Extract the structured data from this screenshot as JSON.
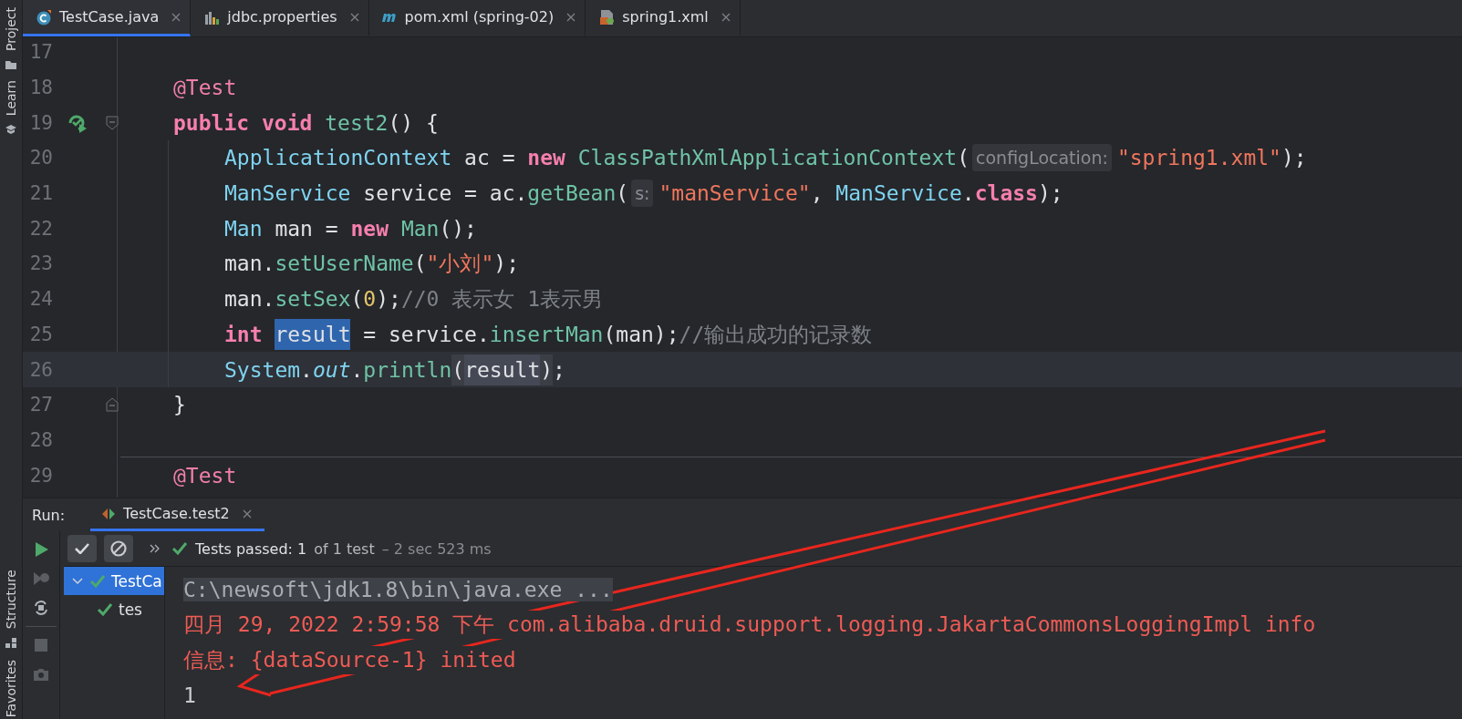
{
  "tool_strip": {
    "top": [
      {
        "label": "Project"
      },
      {
        "label": "Learn"
      }
    ],
    "bottom": [
      {
        "label": "Structure"
      },
      {
        "label": "Favorites"
      }
    ]
  },
  "tabs": [
    {
      "label": "TestCase.java",
      "selected": true
    },
    {
      "label": "jdbc.properties",
      "selected": false
    },
    {
      "label": "pom.xml (spring-02)",
      "selected": false
    },
    {
      "label": "spring1.xml",
      "selected": false
    }
  ],
  "editor": {
    "lines": [
      {
        "number": "17",
        "indented": false
      },
      {
        "number": "18",
        "indented": false,
        "tokens": [
          {
            "kind": "anno",
            "t": "@Test"
          }
        ]
      },
      {
        "number": "19",
        "indented": false,
        "run_icon": true,
        "fold_open": true,
        "tokens": [
          {
            "kind": "kw",
            "t": "public "
          },
          {
            "kind": "kw",
            "t": "void "
          },
          {
            "kind": "call",
            "t": "test2"
          },
          {
            "kind": "plain",
            "t": "() {"
          }
        ]
      },
      {
        "number": "20",
        "indented": true,
        "tokens": [
          {
            "kind": "type",
            "t": "ApplicationContext"
          },
          {
            "kind": "plain",
            "t": " ac = "
          },
          {
            "kind": "kw",
            "t": "new "
          },
          {
            "kind": "call",
            "t": "ClassPathXmlApplicationContext"
          },
          {
            "kind": "plain",
            "t": "("
          },
          {
            "kind": "hint",
            "t": "configLocation:"
          },
          {
            "kind": "str",
            "t": "\"spring1.xml\""
          },
          {
            "kind": "plain",
            "t": ");"
          }
        ]
      },
      {
        "number": "21",
        "indented": true,
        "tokens": [
          {
            "kind": "type",
            "t": "ManService"
          },
          {
            "kind": "plain",
            "t": " service = ac."
          },
          {
            "kind": "call",
            "t": "getBean"
          },
          {
            "kind": "plain",
            "t": "("
          },
          {
            "kind": "hint",
            "t": "s:"
          },
          {
            "kind": "str",
            "t": "\"manService\""
          },
          {
            "kind": "plain",
            "t": ", "
          },
          {
            "kind": "type",
            "t": "ManService"
          },
          {
            "kind": "plain",
            "t": "."
          },
          {
            "kind": "kw",
            "t": "class"
          },
          {
            "kind": "plain",
            "t": ");"
          }
        ]
      },
      {
        "number": "22",
        "indented": true,
        "tokens": [
          {
            "kind": "type",
            "t": "Man"
          },
          {
            "kind": "plain",
            "t": " man = "
          },
          {
            "kind": "kw",
            "t": "new "
          },
          {
            "kind": "call",
            "t": "Man"
          },
          {
            "kind": "plain",
            "t": "();"
          }
        ]
      },
      {
        "number": "23",
        "indented": true,
        "tokens": [
          {
            "kind": "plain",
            "t": "man."
          },
          {
            "kind": "call",
            "t": "setUserName"
          },
          {
            "kind": "plain",
            "t": "("
          },
          {
            "kind": "str",
            "t": "\"小刘\""
          },
          {
            "kind": "plain",
            "t": ");"
          }
        ]
      },
      {
        "number": "24",
        "indented": true,
        "tokens": [
          {
            "kind": "plain",
            "t": "man."
          },
          {
            "kind": "call",
            "t": "setSex"
          },
          {
            "kind": "plain",
            "t": "("
          },
          {
            "kind": "num",
            "t": "0"
          },
          {
            "kind": "plain",
            "t": ");"
          },
          {
            "kind": "comment",
            "t": "//0 表示女 1表示男"
          }
        ]
      },
      {
        "number": "25",
        "indented": true,
        "tokens": [
          {
            "kind": "kw",
            "t": "int "
          },
          {
            "kind": "sel",
            "t": "result"
          },
          {
            "kind": "plain",
            "t": " = service."
          },
          {
            "kind": "call",
            "t": "insertMan"
          },
          {
            "kind": "plain",
            "t": "(man);"
          },
          {
            "kind": "comment",
            "t": "//输出成功的记录数"
          }
        ]
      },
      {
        "number": "26",
        "indented": true,
        "current": true,
        "tokens": [
          {
            "kind": "type",
            "t": "System"
          },
          {
            "kind": "plain",
            "t": "."
          },
          {
            "kind": "field",
            "t": "out"
          },
          {
            "kind": "plain",
            "t": "."
          },
          {
            "kind": "call",
            "t": "println"
          },
          {
            "kind": "brace",
            "t": "("
          },
          {
            "kind": "usage",
            "t": "result"
          },
          {
            "kind": "brace",
            "t": ")"
          },
          {
            "kind": "plain",
            "t": ";"
          }
        ]
      },
      {
        "number": "27",
        "indented": false,
        "fold_close": true,
        "tokens": [
          {
            "kind": "plain",
            "t": "}"
          }
        ]
      },
      {
        "number": "28",
        "indented": false
      },
      {
        "number": "29",
        "indented": false,
        "separator_above": true,
        "tokens": [
          {
            "kind": "anno",
            "t": "@Test"
          }
        ]
      }
    ]
  },
  "run_panel": {
    "label": "Run:",
    "tab": {
      "label": "TestCase.test2",
      "selected": true
    },
    "status": {
      "summary": "Tests passed: 1",
      "count": "of 1 test",
      "duration": "– 2 sec 523 ms"
    },
    "tree": [
      {
        "label": "TestCa",
        "passed": true,
        "selected": true,
        "expanded": true,
        "children": [
          {
            "label": "tes",
            "passed": true,
            "selected": false
          }
        ]
      }
    ],
    "console": [
      {
        "kind": "command",
        "text": "C:\\newsoft\\jdk1.8\\bin\\java.exe ..."
      },
      {
        "kind": "log",
        "text": "四月 29, 2022 2:59:58 下午 com.alibaba.druid.support.logging.JakartaCommonsLoggingImpl info"
      },
      {
        "kind": "log",
        "text": "信息: {dataSource-1} inited"
      },
      {
        "kind": "output",
        "text": "1"
      }
    ]
  },
  "annotation": {
    "kind": "arrow"
  }
}
